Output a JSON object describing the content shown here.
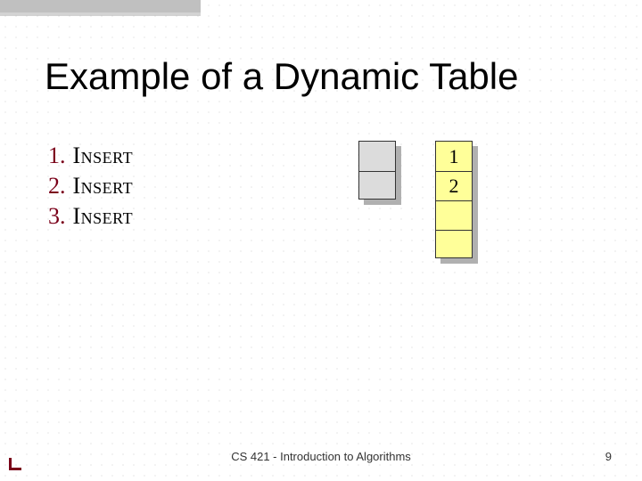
{
  "title": "Example of a Dynamic Table",
  "list": [
    {
      "num": "1.",
      "op": "Insert"
    },
    {
      "num": "2.",
      "op": "Insert"
    },
    {
      "num": "3.",
      "op": "Insert"
    }
  ],
  "old_table": {
    "cells": [
      "",
      ""
    ]
  },
  "new_table": {
    "cells": [
      "1",
      "2",
      "",
      ""
    ]
  },
  "footer_center": "CS 421 - Introduction to Algorithms",
  "footer_right": "9"
}
